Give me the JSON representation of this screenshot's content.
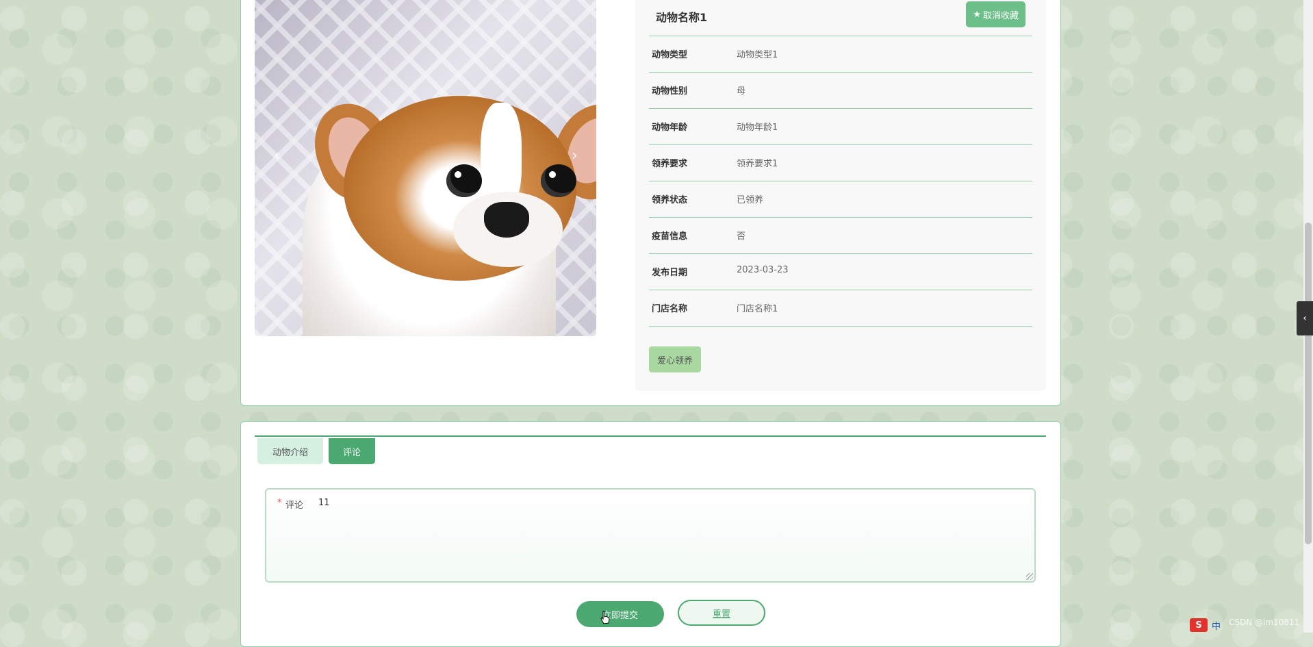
{
  "detail": {
    "title": "动物名称1",
    "favorite_button": "取消收藏",
    "favorite_icon": "★",
    "rows": [
      {
        "label": "动物类型",
        "value": "动物类型1"
      },
      {
        "label": "动物性别",
        "value": "母"
      },
      {
        "label": "动物年龄",
        "value": "动物年龄1"
      },
      {
        "label": "领养要求",
        "value": "领养要求1"
      },
      {
        "label": "领养状态",
        "value": "已领养"
      },
      {
        "label": "疫苗信息",
        "value": "否"
      },
      {
        "label": "发布日期",
        "value": "2023-03-23"
      },
      {
        "label": "门店名称",
        "value": "门店名称1"
      }
    ],
    "adopt_button": "爱心领养"
  },
  "carousel": {
    "prev_arrow": "‹",
    "next_arrow": "›",
    "slides_total": 3,
    "active_slide": 1
  },
  "tabs": [
    {
      "label": "动物介绍"
    },
    {
      "label": "评论"
    }
  ],
  "comment_form": {
    "required_mark": "*",
    "label": "评论",
    "value": "11",
    "submit_button": "立即提交",
    "reset_button": "重置"
  },
  "side_toggle": "‹",
  "watermark": "CSDN @lm10811",
  "ime": {
    "logo": "S",
    "mode": "中"
  },
  "colors": {
    "primary_green": "#4aa870",
    "light_green": "#a9d8a0",
    "border_green": "#8fd0a8",
    "tab_inactive": "#d5efe0"
  }
}
